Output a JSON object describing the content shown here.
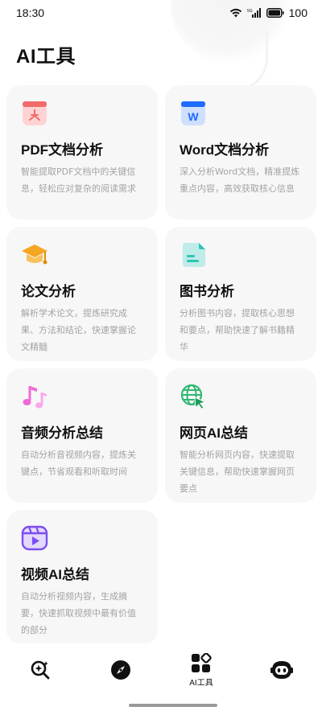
{
  "status": {
    "time": "18:30",
    "battery": "100"
  },
  "page": {
    "title": "AI工具"
  },
  "cards": [
    {
      "title": "PDF文档分析",
      "desc": "智能提取PDF文档中的关键信息，轻松应对复杂的阅读需求",
      "icon": "pdf-document-icon"
    },
    {
      "title": "Word文档分析",
      "desc": "深入分析Word文档，精准提炼重点内容，高效获取核心信息",
      "icon": "word-document-icon"
    },
    {
      "title": "论文分析",
      "desc": "解析学术论文，提炼研究成果、方法和结论，快速掌握论文精髓",
      "icon": "graduation-cap-icon"
    },
    {
      "title": "图书分析",
      "desc": "分析图书内容，提取核心思想和要点，帮助快速了解书籍精华",
      "icon": "book-document-icon"
    },
    {
      "title": "音频分析总结",
      "desc": "自动分析音视频内容，提炼关键点，节省观看和听取时间",
      "icon": "music-notes-icon"
    },
    {
      "title": "网页AI总结",
      "desc": "智能分析网页内容，快速提取关键信息，帮助快速掌握网页要点",
      "icon": "globe-cursor-icon"
    },
    {
      "title": "视频AI总结",
      "desc": "自动分析视频内容，生成摘要，快速抓取视频中最有价值的部分",
      "icon": "video-play-icon"
    }
  ],
  "tabs": [
    {
      "label": "",
      "icon": "search-ai-icon"
    },
    {
      "label": "",
      "icon": "compass-icon"
    },
    {
      "label": "AI工具",
      "icon": "ai-tools-grid-icon",
      "selected": true
    },
    {
      "label": "",
      "icon": "robot-face-icon"
    }
  ],
  "colors": {
    "pdf": "#f26b6b",
    "word": "#1f6bff",
    "cap": "#f5a623",
    "book": "#2ec4b6",
    "music": "#f06ad8",
    "globe": "#2eb872",
    "video": "#7b4df2"
  }
}
